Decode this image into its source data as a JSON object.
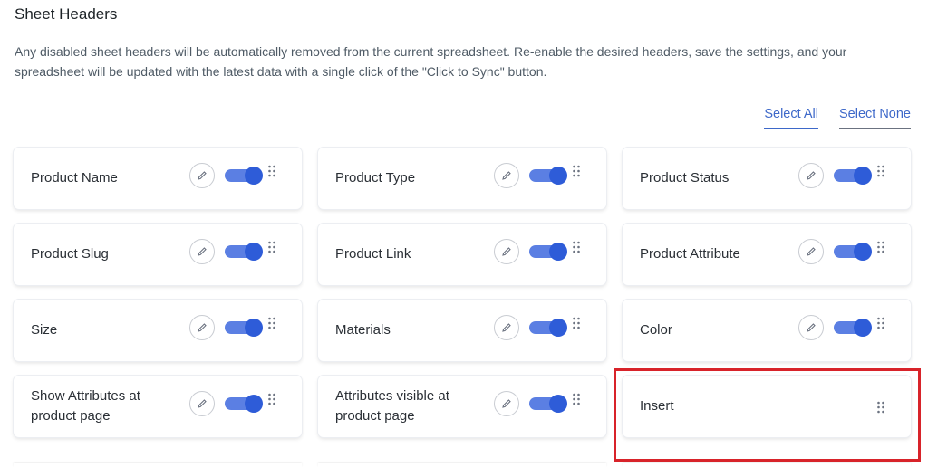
{
  "section": {
    "title": "Sheet Headers",
    "description": "Any disabled sheet headers will be automatically removed from the current spreadsheet. Re-enable the desired headers, save the settings, and your spreadsheet will be updated with the latest data with a single click of the \"Click to Sync\" button."
  },
  "selection": {
    "select_all": "Select All",
    "select_none": "Select None"
  },
  "headers": [
    {
      "label": "Product Name",
      "enabled": true
    },
    {
      "label": "Product Type",
      "enabled": true
    },
    {
      "label": "Product Status",
      "enabled": true
    },
    {
      "label": "Product Slug",
      "enabled": true
    },
    {
      "label": "Product Link",
      "enabled": true
    },
    {
      "label": "Product Attribute",
      "enabled": true
    },
    {
      "label": "Size",
      "enabled": true
    },
    {
      "label": "Materials",
      "enabled": true
    },
    {
      "label": "Color",
      "enabled": true
    },
    {
      "label": "Show Attributes at product page",
      "enabled": true
    },
    {
      "label": "Attributes visible at product page",
      "enabled": true
    },
    {
      "label": "Insert",
      "enabled": null
    }
  ],
  "colors": {
    "accent": "#3d68c9",
    "toggle_on": "#2e5cd8",
    "highlight": "#d8232a"
  },
  "icons": {
    "edit": "pencil-icon",
    "drag": "drag-handle-icon"
  }
}
